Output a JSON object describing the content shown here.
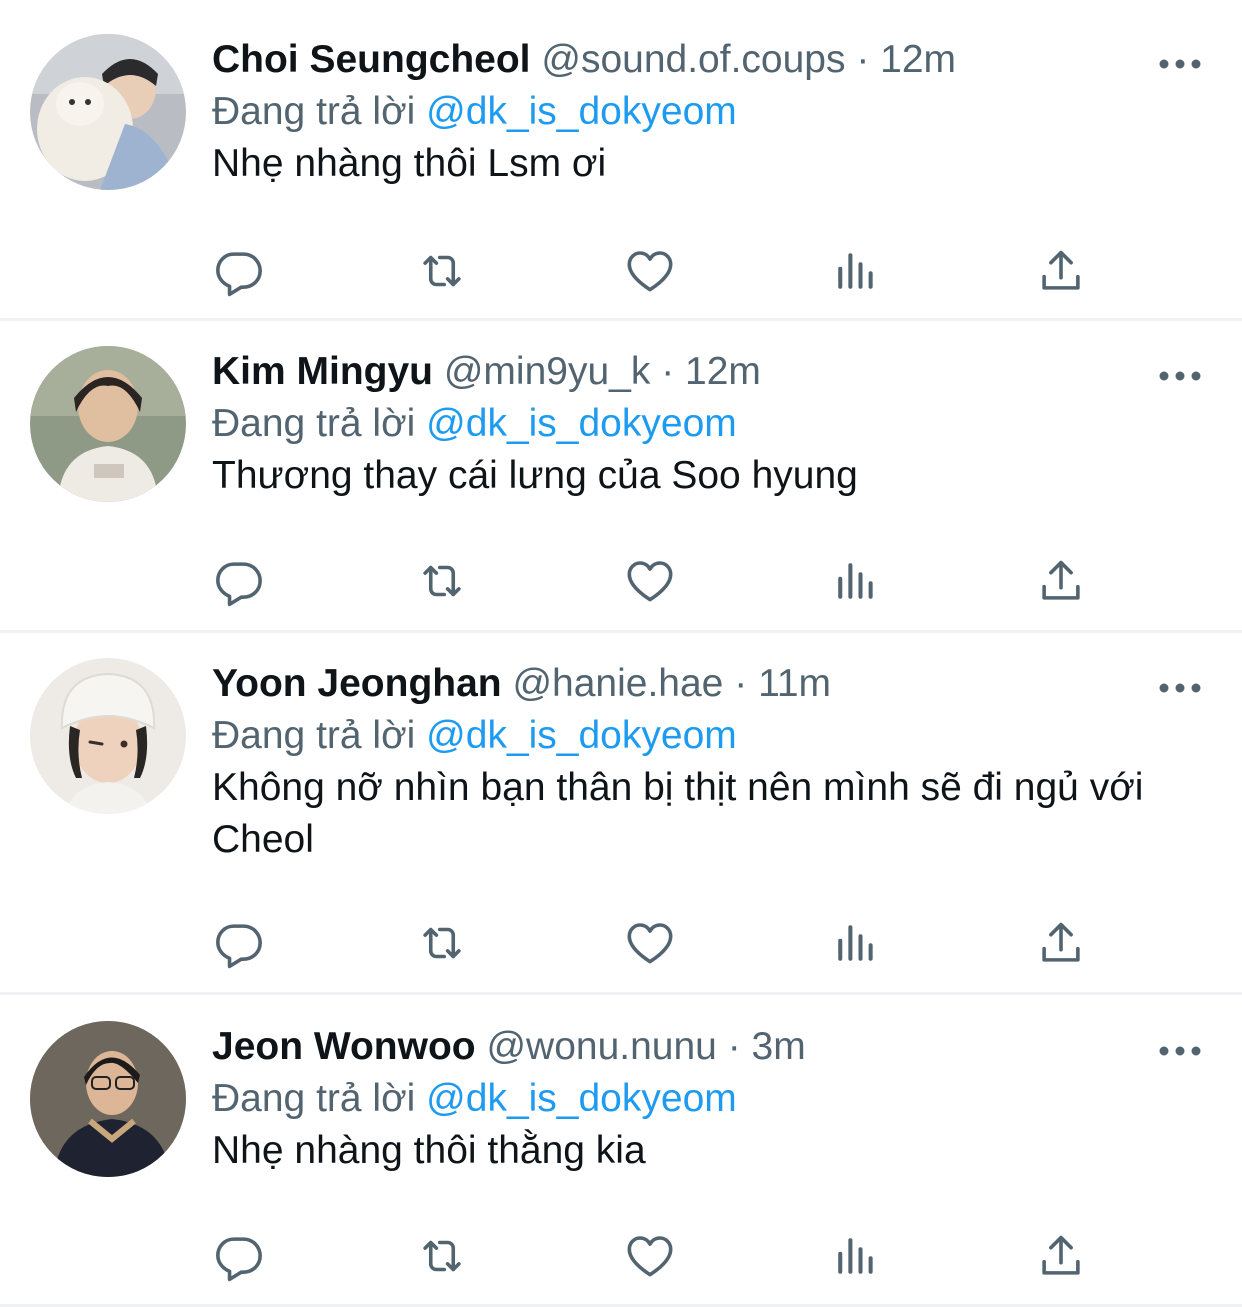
{
  "tweets": [
    {
      "name": "Choi Seungcheol",
      "handle": "@sound.of.coups",
      "dot": "·",
      "time": "12m",
      "reply_prefix": "Đang trả lời",
      "reply_to": "@dk_is_dokyeom",
      "text": "Nhẹ nhàng thôi Lsm ơi"
    },
    {
      "name": "Kim Mingyu",
      "handle": "@min9yu_k",
      "dot": "·",
      "time": "12m",
      "reply_prefix": "Đang trả lời",
      "reply_to": "@dk_is_dokyeom",
      "text": "Thương thay cái lưng của Soo hyung"
    },
    {
      "name": "Yoon Jeonghan",
      "handle": "@hanie.hae",
      "dot": "·",
      "time": "11m",
      "reply_prefix": "Đang trả lời",
      "reply_to": "@dk_is_dokyeom",
      "text": "Không nỡ nhìn bạn thân bị thịt nên mình sẽ đi ngủ với Cheol"
    },
    {
      "name": "Jeon Wonwoo",
      "handle": "@wonu.nunu",
      "dot": "·",
      "time": "3m",
      "reply_prefix": "Đang trả lời",
      "reply_to": "@dk_is_dokyeom",
      "text": "Nhẹ nhàng thôi thằng kia"
    }
  ],
  "icons": {
    "reply": "reply-icon",
    "retweet": "retweet-icon",
    "like": "heart-icon",
    "views": "analytics-icon",
    "share": "share-icon",
    "more": "more-icon"
  },
  "colors": {
    "text": "#0f1419",
    "secondary": "#536471",
    "mention": "#1d9bf0",
    "separator": "#eff1f3"
  }
}
